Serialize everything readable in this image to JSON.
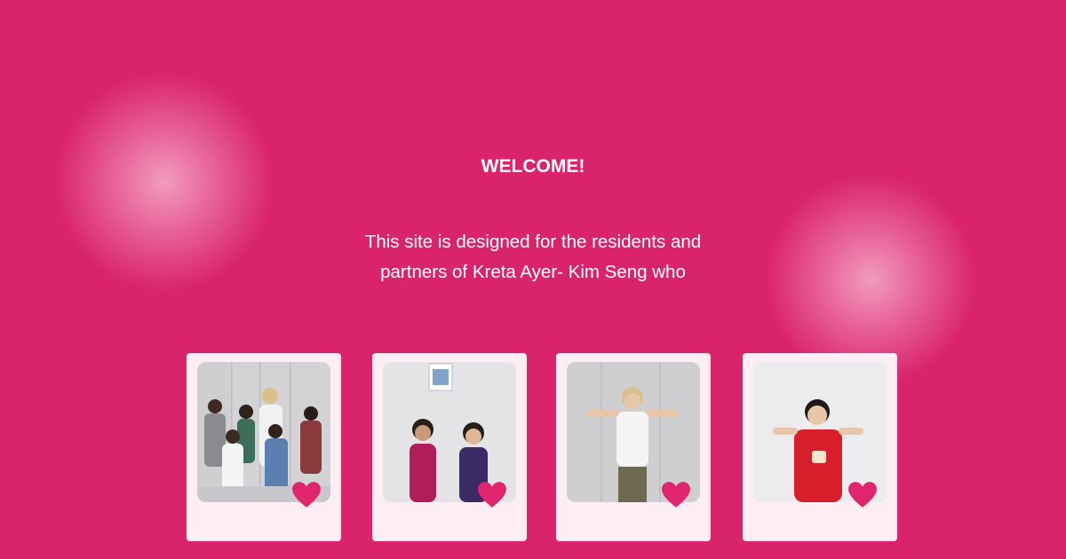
{
  "page": {
    "welcome_heading": "WELCOME!",
    "description_line1": "This site is designed for the residents and",
    "description_line2": "partners of Kreta Ayer- Kim Seng who"
  },
  "colors": {
    "background": "#d9246b",
    "polaroid_frame": "#fceef3",
    "heart": "#e0246e",
    "text": "#ffffff"
  },
  "photos": [
    {
      "subject": "group of children with woman",
      "icon": "heart-icon"
    },
    {
      "subject": "two girls",
      "icon": "heart-icon"
    },
    {
      "subject": "woman",
      "icon": "heart-icon"
    },
    {
      "subject": "boy",
      "icon": "heart-icon"
    }
  ]
}
